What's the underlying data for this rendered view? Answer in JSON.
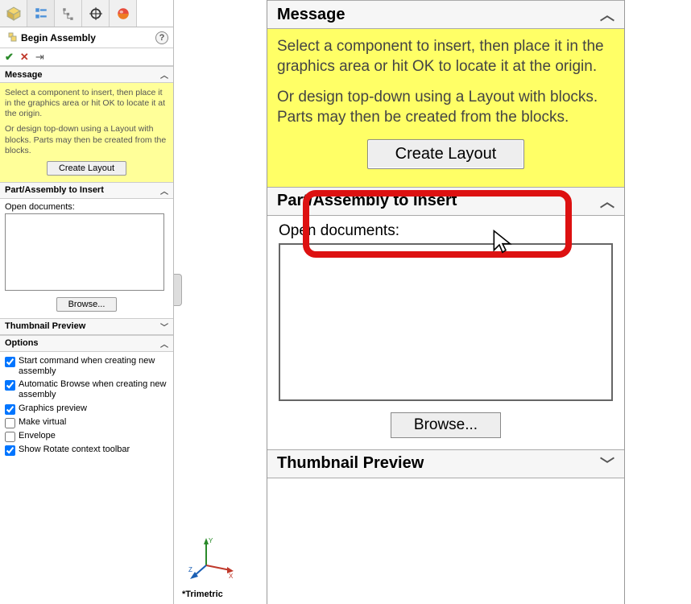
{
  "panel_title": "Begin Assembly",
  "sections": {
    "message": {
      "label": "Message",
      "para1": "Select a component to insert, then place it in the graphics area or hit OK to locate it at the origin.",
      "para2": "Or design top-down using a Layout with blocks. Parts may then be created from the blocks.",
      "create_layout_btn": "Create Layout"
    },
    "insert": {
      "label": "Part/Assembly to Insert",
      "open_docs_label": "Open documents:",
      "browse_btn": "Browse..."
    },
    "thumbnail": {
      "label": "Thumbnail Preview"
    },
    "options": {
      "label": "Options",
      "opt1": "Start command when creating new assembly",
      "opt2": "Automatic Browse when creating new assembly",
      "opt3": "Graphics preview",
      "opt4": "Make virtual",
      "opt5": "Envelope",
      "opt6": "Show Rotate context toolbar"
    }
  },
  "triad_label": "*Trimetric",
  "right": {
    "message_label": "Message",
    "para1": "Select a component to insert, then place it in the graphics area or hit OK to locate it at the origin.",
    "para2": "Or design top-down using a Layout with blocks. Parts may then be created from the blocks.",
    "create_layout_btn": "Create Layout",
    "insert_label": "Part/Assembly to Insert",
    "open_docs_label": "Open documents:",
    "browse_btn": "Browse...",
    "thumbnail_label": "Thumbnail Preview"
  }
}
